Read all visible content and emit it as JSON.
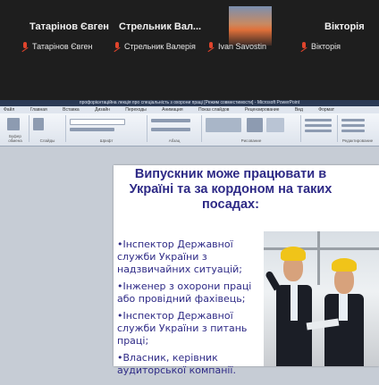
{
  "participants": [
    {
      "tile_name": "Татарінов Євген",
      "label": "Татарінов Євген"
    },
    {
      "tile_name": "Стрельник Вал...",
      "label": "Стрельник Валерія"
    },
    {
      "tile_name": "",
      "label": "Ivan Savostin"
    },
    {
      "tile_name": "Вікторія",
      "label": "Вікторія"
    }
  ],
  "powerpoint": {
    "window_title": "профорієнтаційна лекція про спеціальність з охорони праці [Режим совместимости] - Microsoft PowerPoint",
    "tabs": [
      "Файл",
      "Главная",
      "Вставка",
      "Дизайн",
      "Переходы",
      "Анимация",
      "Показ слайдов",
      "Рецензирование",
      "Вид",
      "Формат"
    ],
    "groups": [
      "Буфер обмена",
      "Слайды",
      "Шрифт",
      "Абзац",
      "Рисование",
      "Редактирование"
    ]
  },
  "slide": {
    "title": "Випускник може працювати в Україні та за кордоном на таких посадах:",
    "bullets": [
      "•Інспектор Державної служби України з надзвичайних ситуацій;",
      "•Інженер з охорони праці або провідний фахівець;",
      "•Інспектор Державної служби України з питань праці;",
      "•Власник, керівник аудиторської компанії."
    ]
  },
  "colors": {
    "slide_text": "#2e2a86",
    "mic_muted": "#e0442c",
    "titlebar": "#2b3a55"
  },
  "icons": [
    "mic-muted-icon",
    "camera-video"
  ]
}
